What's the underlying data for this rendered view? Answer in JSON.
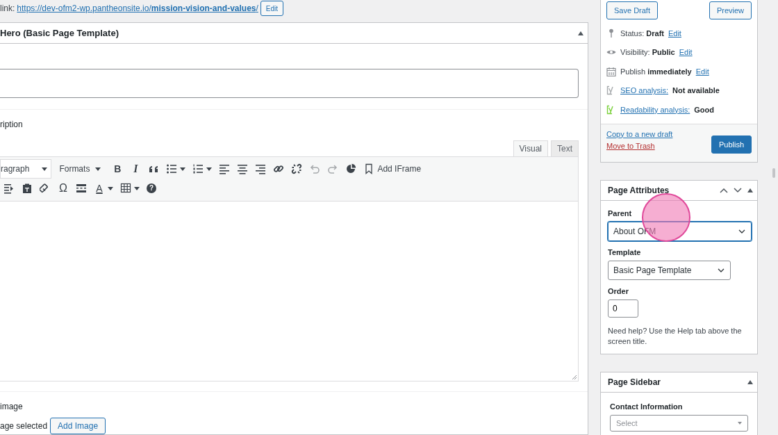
{
  "permalink": {
    "label": "link:",
    "url": "https://dev-ofm2-wp.pantheonsite.io/**mission-vision-and-values**/",
    "edit_button": "Edit"
  },
  "hero_panel": {
    "title": "Hero (Basic Page Template)",
    "description_label": "ription",
    "editor": {
      "tabs": [
        {
          "label": "Visual",
          "selected": true
        },
        {
          "label": "Text",
          "selected": false
        }
      ],
      "toolbar_rows": [
        [
          {
            "kind": "select",
            "label": "ragraph"
          },
          {
            "kind": "menu",
            "label": "Formats"
          },
          {
            "kind": "bold",
            "glyph": "B",
            "disabled": false
          },
          {
            "kind": "italic",
            "glyph": "I",
            "disabled": false
          },
          {
            "kind": "quote",
            "disabled": false
          },
          {
            "kind": "bullets",
            "caret": true,
            "disabled": false
          },
          {
            "kind": "numbers",
            "caret": true,
            "disabled": false
          },
          {
            "kind": "alignleft",
            "disabled": false
          },
          {
            "kind": "aligncenter",
            "disabled": false
          },
          {
            "kind": "alignright",
            "disabled": false
          },
          {
            "kind": "link",
            "disabled": false
          },
          {
            "kind": "unlink",
            "disabled": false
          },
          {
            "kind": "undo",
            "disabled": true
          },
          {
            "kind": "redo",
            "disabled": true
          },
          {
            "kind": "chart",
            "disabled": false
          },
          {
            "kind": "iframe",
            "label": "Add IFrame"
          }
        ],
        [
          {
            "kind": "indent",
            "disabled": false
          },
          {
            "kind": "paste",
            "disabled": false
          },
          {
            "kind": "eraser",
            "disabled": false
          },
          {
            "kind": "omega",
            "glyph": "Ω",
            "disabled": false
          },
          {
            "kind": "more",
            "disabled": false
          },
          {
            "kind": "textcolor",
            "glyph": "A",
            "caret": true,
            "disabled": false
          },
          {
            "kind": "table",
            "caret": true,
            "disabled": false
          },
          {
            "kind": "help",
            "glyph": "?",
            "disabled": false
          }
        ]
      ]
    },
    "image_label": "image",
    "image_status": "age selected",
    "add_image_button": "Add Image"
  },
  "publish_box": {
    "save_draft": "Save Draft",
    "preview": "Preview",
    "rows": [
      {
        "kind": "pin",
        "text": "Status: **Draft**",
        "link": "Edit"
      },
      {
        "kind": "eye",
        "text": "Visibility: **Public**",
        "link": "Edit"
      },
      {
        "kind": "calendar",
        "text": "Publish **immediately**",
        "link": "Edit"
      },
      {
        "kind": "yoast",
        "color": "#a7aaad",
        "link": "SEO analysis:",
        "value": "Not available"
      },
      {
        "kind": "yoast",
        "color": "#7ad03a",
        "link": "Readability analysis:",
        "value": "Good"
      }
    ],
    "copy_link": "Copy to a new draft",
    "trash_link": "Move to Trash",
    "publish_button": "Publish"
  },
  "page_attributes": {
    "title": "Page Attributes",
    "parent_label": "Parent",
    "parent_value": "About OFM",
    "parent_focused": true,
    "template_label": "Template",
    "template_value": "Basic Page Template",
    "order_label": "Order",
    "order_value": "0",
    "help": "Need help? Use the Help tab above the screen title."
  },
  "page_sidebar": {
    "title": "Page Sidebar",
    "contact_label": "Contact Information",
    "contact_select": {
      "placeholder": "Select"
    }
  }
}
